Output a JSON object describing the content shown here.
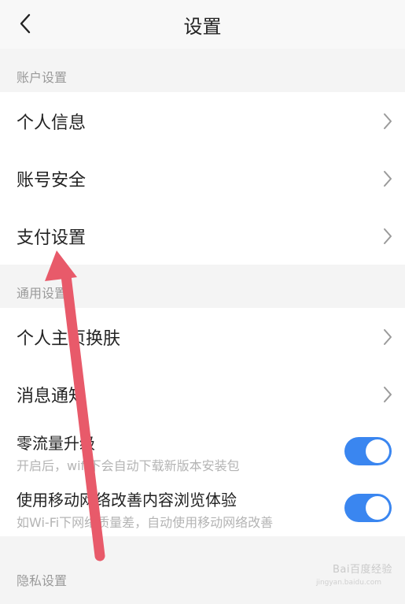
{
  "header": {
    "title": "设置",
    "back_icon": "chevron-left-icon"
  },
  "sections": {
    "account": {
      "header": "账户设置",
      "items": [
        {
          "label": "个人信息"
        },
        {
          "label": "账号安全"
        },
        {
          "label": "支付设置"
        }
      ]
    },
    "general": {
      "header": "通用设置",
      "items": [
        {
          "label": "个人主页换肤"
        },
        {
          "label": "消息通知"
        }
      ],
      "toggles": [
        {
          "title": "零流量升级",
          "subtitle": "开启后，wifi下会自动下载新版本安装包",
          "on": true
        },
        {
          "title": "使用移动网络改善内容浏览体验",
          "subtitle": "如Wi-Fi下网络质量差，自动使用移动网络改善",
          "on": true
        }
      ]
    },
    "privacy": {
      "header": "隐私设置"
    }
  },
  "watermark": {
    "text": "Bai百度经验",
    "url": "jingyan.baidu.com"
  },
  "colors": {
    "toggle_on": "#3a86f0",
    "annotation_arrow": "#e85a6a",
    "page_bg": "#f4f4f4"
  }
}
